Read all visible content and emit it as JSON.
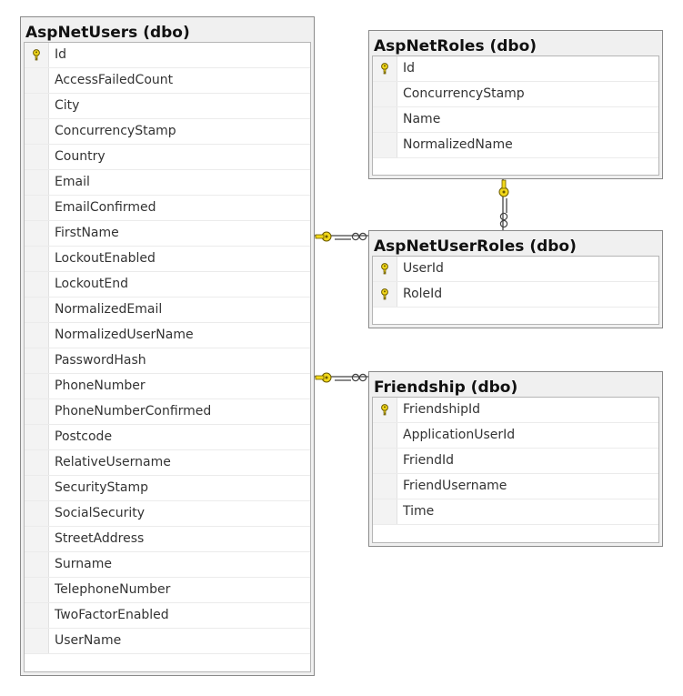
{
  "tables": {
    "users": {
      "title": "AspNetUsers (dbo)",
      "columns": [
        {
          "name": "Id",
          "key": true
        },
        {
          "name": "AccessFailedCount",
          "key": false
        },
        {
          "name": "City",
          "key": false
        },
        {
          "name": "ConcurrencyStamp",
          "key": false
        },
        {
          "name": "Country",
          "key": false
        },
        {
          "name": "Email",
          "key": false
        },
        {
          "name": "EmailConfirmed",
          "key": false
        },
        {
          "name": "FirstName",
          "key": false
        },
        {
          "name": "LockoutEnabled",
          "key": false
        },
        {
          "name": "LockoutEnd",
          "key": false
        },
        {
          "name": "NormalizedEmail",
          "key": false
        },
        {
          "name": "NormalizedUserName",
          "key": false
        },
        {
          "name": "PasswordHash",
          "key": false
        },
        {
          "name": "PhoneNumber",
          "key": false
        },
        {
          "name": "PhoneNumberConfirmed",
          "key": false
        },
        {
          "name": "Postcode",
          "key": false
        },
        {
          "name": "RelativeUsername",
          "key": false
        },
        {
          "name": "SecurityStamp",
          "key": false
        },
        {
          "name": "SocialSecurity",
          "key": false
        },
        {
          "name": "StreetAddress",
          "key": false
        },
        {
          "name": "Surname",
          "key": false
        },
        {
          "name": "TelephoneNumber",
          "key": false
        },
        {
          "name": "TwoFactorEnabled",
          "key": false
        },
        {
          "name": "UserName",
          "key": false
        }
      ]
    },
    "roles": {
      "title": "AspNetRoles (dbo)",
      "columns": [
        {
          "name": "Id",
          "key": true
        },
        {
          "name": "ConcurrencyStamp",
          "key": false
        },
        {
          "name": "Name",
          "key": false
        },
        {
          "name": "NormalizedName",
          "key": false
        }
      ]
    },
    "userroles": {
      "title": "AspNetUserRoles (dbo)",
      "columns": [
        {
          "name": "UserId",
          "key": true
        },
        {
          "name": "RoleId",
          "key": true
        }
      ]
    },
    "friendship": {
      "title": "Friendship (dbo)",
      "columns": [
        {
          "name": "FriendshipId",
          "key": true
        },
        {
          "name": "ApplicationUserId",
          "key": false
        },
        {
          "name": "FriendId",
          "key": false
        },
        {
          "name": "FriendUsername",
          "key": false
        },
        {
          "name": "Time",
          "key": false
        }
      ]
    }
  },
  "relationships": [
    {
      "from": "users",
      "to": "userroles",
      "one_end": "users",
      "many_end": "userroles"
    },
    {
      "from": "roles",
      "to": "userroles",
      "one_end": "roles",
      "many_end": "userroles"
    },
    {
      "from": "users",
      "to": "friendship",
      "one_end": "users",
      "many_end": "friendship"
    }
  ],
  "colors": {
    "key_fill": "#f2d81a",
    "key_stroke": "#6b5a00",
    "connector": "#444444",
    "header_bg": "#f0f0f0"
  },
  "icons": {
    "primary_key": "key-icon",
    "relationship_one": "key-connector-icon",
    "relationship_many": "infinity-icon"
  }
}
